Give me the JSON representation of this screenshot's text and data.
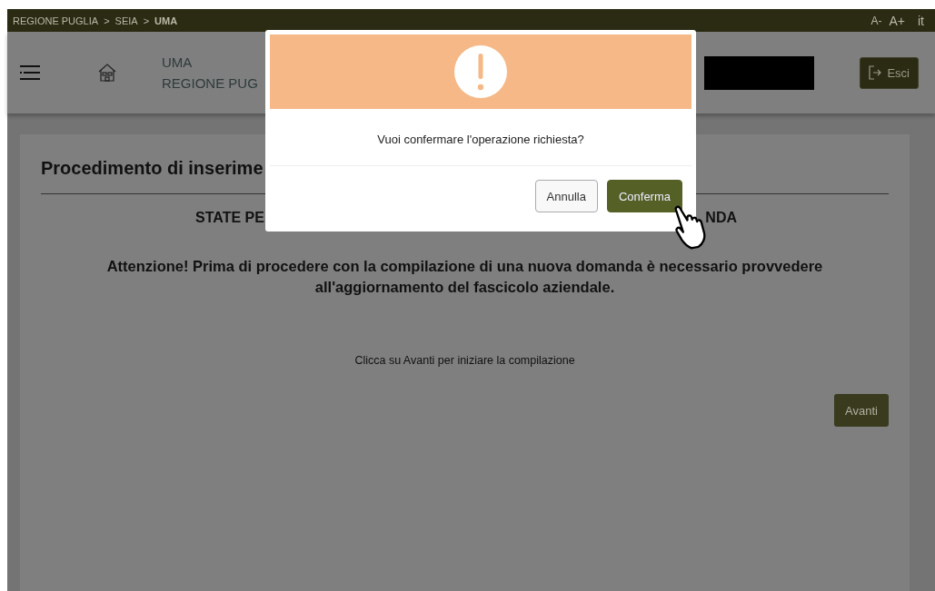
{
  "top_bar": {
    "breadcrumb": [
      {
        "label": "REGIONE PUGLIA",
        "current": false
      },
      {
        "label": "SEIA",
        "current": false
      },
      {
        "label": "UMA",
        "current": true
      }
    ],
    "separator": ">",
    "font_controls": [
      "A-",
      "A+"
    ],
    "language": "it"
  },
  "header": {
    "app_name": "UMA",
    "region": "REGIONE PUG",
    "logout_button": "Esci"
  },
  "card": {
    "title": "Procedimento di inserime",
    "subtitle_left": "STATE PE",
    "subtitle_right": "NDA",
    "warning": "Attenzione! Prima di procedere con la compilazione di una nuova domanda è necessario provvedere all'aggiornamento del fascicolo aziendale.",
    "hint": "Clicca su Avanti per iniziare la compilazione",
    "next_button": "Avanti"
  },
  "dialog": {
    "message": "Vuoi confermare l'operazione richiesta?",
    "buttons": [
      {
        "label": "Annulla",
        "kind": "secondary"
      },
      {
        "label": "Conferma",
        "kind": "primary"
      }
    ]
  }
}
